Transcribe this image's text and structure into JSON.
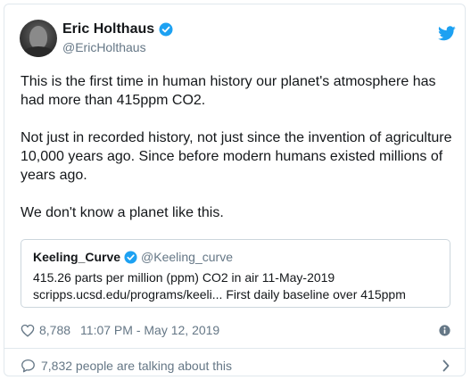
{
  "author": {
    "display_name": "Eric Holthaus",
    "handle": "@EricHolthaus"
  },
  "tweet": {
    "paragraphs": [
      "This is the first time in human history our planet's atmosphere has had more than 415ppm CO2.",
      "Not just in recorded history, not just since the invention of agriculture 10,000 years ago. Since before modern humans existed millions of years ago.",
      "We don't know a planet like this."
    ]
  },
  "quoted_tweet": {
    "display_name": "Keeling_Curve",
    "handle": "@Keeling_curve",
    "line1": "415.26 parts per million (ppm) CO2 in air 11-May-2019",
    "line2": "scripps.ucsd.edu/programs/keeli... First daily baseline over 415ppm"
  },
  "meta": {
    "likes": "8,788",
    "timestamp": "11:07 PM - May 12, 2019"
  },
  "footer": {
    "talking": "7,832 people are talking about this"
  },
  "colors": {
    "twitter_blue": "#1da1f2",
    "secondary_text": "#657786",
    "border": "#e1e8ed"
  }
}
